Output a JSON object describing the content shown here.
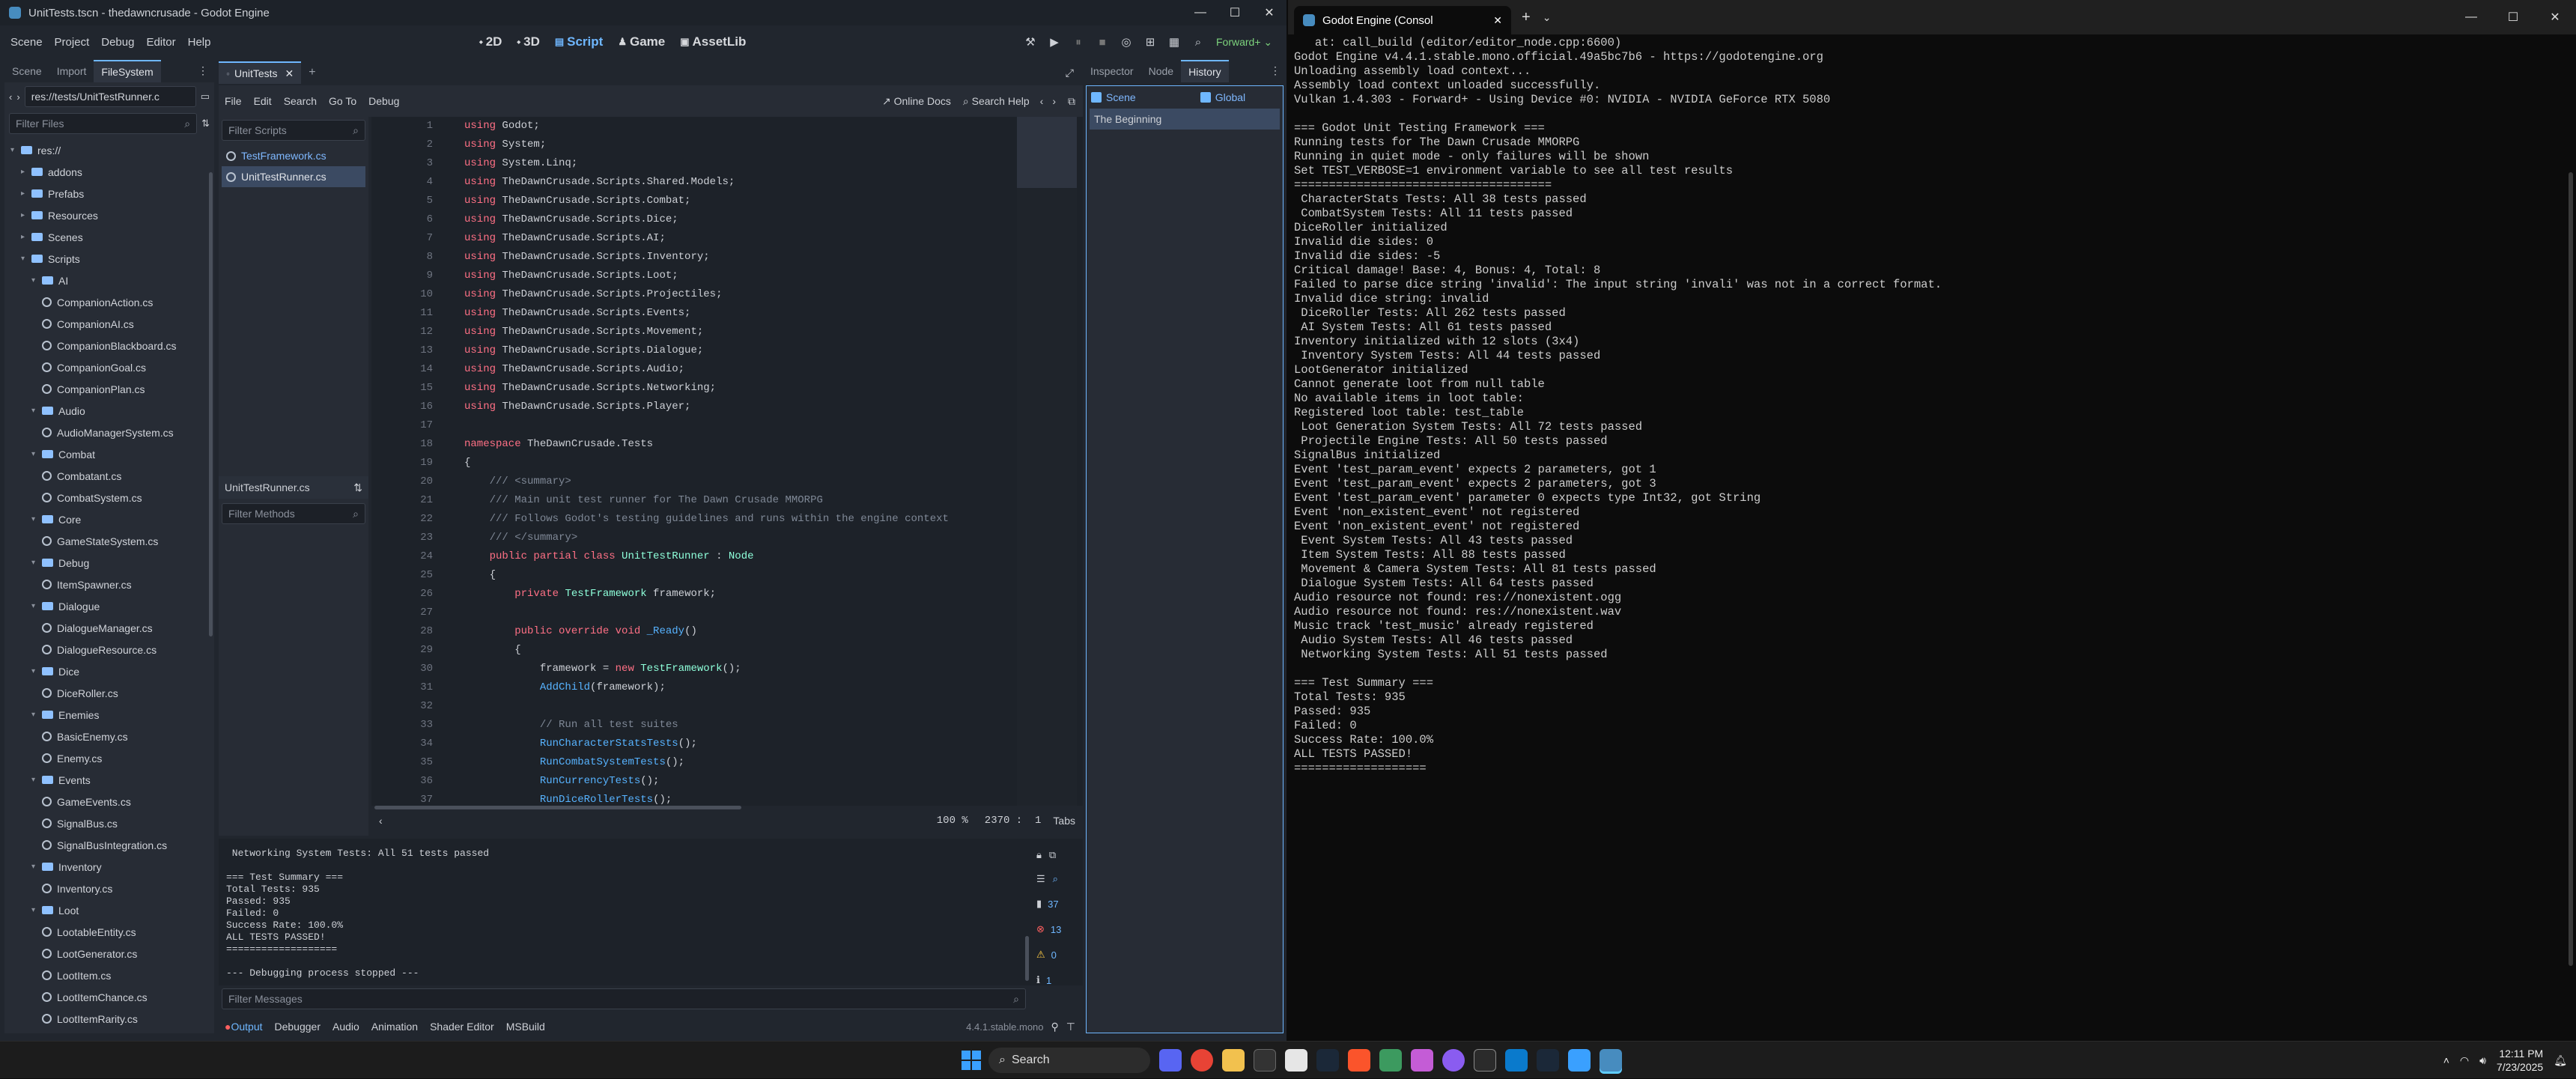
{
  "godot": {
    "window_title": "UnitTests.tscn - thedawncrusade - Godot Engine",
    "menus": [
      "Scene",
      "Project",
      "Debug",
      "Editor",
      "Help"
    ],
    "modes": [
      "2D",
      "3D",
      "Script",
      "Game",
      "AssetLib"
    ],
    "renderer": "Forward+",
    "left_dock": {
      "tabs": [
        "Scene",
        "Import",
        "FileSystem"
      ],
      "path": "res://tests/UnitTestRunner.c",
      "filter_placeholder": "Filter Files",
      "tree": [
        {
          "label": "res://",
          "type": "root"
        },
        {
          "label": "addons",
          "type": "folder",
          "level": 1
        },
        {
          "label": "Prefabs",
          "type": "folder",
          "level": 1
        },
        {
          "label": "Resources",
          "type": "folder",
          "level": 1
        },
        {
          "label": "Scenes",
          "type": "folder",
          "level": 1
        },
        {
          "label": "Scripts",
          "type": "folder",
          "level": 1
        },
        {
          "label": "AI",
          "type": "folder",
          "level": 2
        },
        {
          "label": "CompanionAction.cs",
          "type": "file",
          "level": 3
        },
        {
          "label": "CompanionAI.cs",
          "type": "file",
          "level": 3
        },
        {
          "label": "CompanionBlackboard.cs",
          "type": "file",
          "level": 3
        },
        {
          "label": "CompanionGoal.cs",
          "type": "file",
          "level": 3
        },
        {
          "label": "CompanionPlan.cs",
          "type": "file",
          "level": 3
        },
        {
          "label": "Audio",
          "type": "folder",
          "level": 2
        },
        {
          "label": "AudioManagerSystem.cs",
          "type": "file",
          "level": 3
        },
        {
          "label": "Combat",
          "type": "folder",
          "level": 2
        },
        {
          "label": "Combatant.cs",
          "type": "file",
          "level": 3
        },
        {
          "label": "CombatSystem.cs",
          "type": "file",
          "level": 3
        },
        {
          "label": "Core",
          "type": "folder",
          "level": 2
        },
        {
          "label": "GameStateSystem.cs",
          "type": "file",
          "level": 3
        },
        {
          "label": "Debug",
          "type": "folder",
          "level": 2
        },
        {
          "label": "ItemSpawner.cs",
          "type": "file",
          "level": 3
        },
        {
          "label": "Dialogue",
          "type": "folder",
          "level": 2
        },
        {
          "label": "DialogueManager.cs",
          "type": "file",
          "level": 3
        },
        {
          "label": "DialogueResource.cs",
          "type": "file",
          "level": 3
        },
        {
          "label": "Dice",
          "type": "folder",
          "level": 2
        },
        {
          "label": "DiceRoller.cs",
          "type": "file",
          "level": 3
        },
        {
          "label": "Enemies",
          "type": "folder",
          "level": 2
        },
        {
          "label": "BasicEnemy.cs",
          "type": "file",
          "level": 3
        },
        {
          "label": "Enemy.cs",
          "type": "file",
          "level": 3
        },
        {
          "label": "Events",
          "type": "folder",
          "level": 2
        },
        {
          "label": "GameEvents.cs",
          "type": "file",
          "level": 3
        },
        {
          "label": "SignalBus.cs",
          "type": "file",
          "level": 3
        },
        {
          "label": "SignalBusIntegration.cs",
          "type": "file",
          "level": 3
        },
        {
          "label": "Inventory",
          "type": "folder",
          "level": 2
        },
        {
          "label": "Inventory.cs",
          "type": "file",
          "level": 3
        },
        {
          "label": "Loot",
          "type": "folder",
          "level": 2
        },
        {
          "label": "LootableEntity.cs",
          "type": "file",
          "level": 3
        },
        {
          "label": "LootGenerator.cs",
          "type": "file",
          "level": 3
        },
        {
          "label": "LootItem.cs",
          "type": "file",
          "level": 3
        },
        {
          "label": "LootItemChance.cs",
          "type": "file",
          "level": 3
        },
        {
          "label": "LootItemRarity.cs",
          "type": "file",
          "level": 3
        }
      ]
    },
    "scene_tab": "UnitTests",
    "script_menus": [
      "File",
      "Edit",
      "Search",
      "Go To",
      "Debug"
    ],
    "online_docs": "Online Docs",
    "search_help": "Search Help",
    "filter_scripts": "Filter Scripts",
    "scripts": [
      "TestFramework.cs",
      "UnitTestRunner.cs"
    ],
    "current_script": "UnitTestRunner.cs",
    "filter_methods": "Filter Methods",
    "code_lines": [
      "<span class=kw>using</span> Godot;",
      "<span class=kw>using</span> System;",
      "<span class=kw>using</span> System.Linq;",
      "<span class=kw>using</span> TheDawnCrusade.Scripts.Shared.Models;",
      "<span class=kw>using</span> TheDawnCrusade.Scripts.Combat;",
      "<span class=kw>using</span> TheDawnCrusade.Scripts.Dice;",
      "<span class=kw>using</span> TheDawnCrusade.Scripts.AI;",
      "<span class=kw>using</span> TheDawnCrusade.Scripts.Inventory;",
      "<span class=kw>using</span> TheDawnCrusade.Scripts.Loot;",
      "<span class=kw>using</span> TheDawnCrusade.Scripts.Projectiles;",
      "<span class=kw>using</span> TheDawnCrusade.Scripts.Events;",
      "<span class=kw>using</span> TheDawnCrusade.Scripts.Movement;",
      "<span class=kw>using</span> TheDawnCrusade.Scripts.Dialogue;",
      "<span class=kw>using</span> TheDawnCrusade.Scripts.Audio;",
      "<span class=kw>using</span> TheDawnCrusade.Scripts.Networking;",
      "<span class=kw>using</span> TheDawnCrusade.Scripts.Player;",
      "",
      "<span class=kw>namespace</span> TheDawnCrusade.Tests",
      "{",
      "    <span class=cm>/// &lt;summary&gt;</span>",
      "    <span class=cm>/// Main unit test runner for The Dawn Crusade MMORPG</span>",
      "    <span class=cm>/// Follows Godot's testing guidelines and runs within the engine context</span>",
      "    <span class=cm>/// &lt;/summary&gt;</span>",
      "    <span class=kw>public partial class</span> <span class=ty>UnitTestRunner</span> : <span class=ty>Node</span>",
      "    {",
      "        <span class=kw>private</span> <span class=ty>TestFramework</span> framework;",
      "",
      "        <span class=kw>public override void</span> <span class=fn>_Ready</span>()",
      "        {",
      "            framework = <span class=kw>new</span> <span class=ty>TestFramework</span>();",
      "            <span class=fn>AddChild</span>(framework);",
      "",
      "            <span class=cm>// Run all test suites</span>",
      "            <span class=fn>RunCharacterStatsTests</span>();",
      "            <span class=fn>RunCombatSystemTests</span>();",
      "            <span class=fn>RunCurrencyTests</span>();",
      "            <span class=fn>RunDiceRollerTests</span>();"
    ],
    "zoom": "100 %",
    "cursor_line": "2370",
    "cursor_col": "1",
    "indent_mode": "Tabs",
    "right_dock_tabs": [
      "Inspector",
      "Node",
      "History"
    ],
    "history_scene": "Scene",
    "history_global": "Global",
    "history_item": "The Beginning",
    "output_text": " Networking System Tests: All 51 tests passed\n\n=== Test Summary ===\nTotal Tests: 935\nPassed: 935\nFailed: 0\nSuccess Rate: 100.0%\nALL TESTS PASSED!\n===================\n\n--- Debugging process stopped ---",
    "output_counts": {
      "messages": "37",
      "errors": "13",
      "warnings": "0",
      "info": "1"
    },
    "filter_messages": "Filter Messages",
    "bottom_tabs": [
      "Output",
      "Debugger",
      "Audio",
      "Animation",
      "Shader Editor",
      "MSBuild"
    ],
    "version": "4.4.1.stable.mono"
  },
  "console": {
    "tab_title": "Godot Engine (Consol",
    "lines": [
      "   at: call_build (editor/editor_node.cpp:6600)",
      "Godot Engine v4.4.1.stable.mono.official.49a5bc7b6 - https://godotengine.org",
      "Unloading assembly load context...",
      "Assembly load context unloaded successfully.",
      "Vulkan 1.4.303 - Forward+ - Using Device #0: NVIDIA - NVIDIA GeForce RTX 5080",
      "",
      "=== Godot Unit Testing Framework ===",
      "Running tests for The Dawn Crusade MMORPG",
      "Running in quiet mode - only failures will be shown",
      "Set TEST_VERBOSE=1 environment variable to see all test results",
      "=====================================",
      " CharacterStats Tests: All 38 tests passed",
      " CombatSystem Tests: All 11 tests passed",
      "DiceRoller initialized",
      "Invalid die sides: 0",
      "Invalid die sides: -5",
      "Critical damage! Base: 4, Bonus: 4, Total: 8",
      "Failed to parse dice string 'invalid': The input string 'invali' was not in a correct format.",
      "Invalid dice string: invalid",
      " DiceRoller Tests: All 262 tests passed",
      " AI System Tests: All 61 tests passed",
      "Inventory initialized with 12 slots (3x4)",
      " Inventory System Tests: All 44 tests passed",
      "LootGenerator initialized",
      "Cannot generate loot from null table",
      "No available items in loot table:",
      "Registered loot table: test_table",
      " Loot Generation System Tests: All 72 tests passed",
      " Projectile Engine Tests: All 50 tests passed",
      "SignalBus initialized",
      "Event 'test_param_event' expects 2 parameters, got 1",
      "Event 'test_param_event' expects 2 parameters, got 3",
      "Event 'test_param_event' parameter 0 expects type Int32, got String",
      "Event 'non_existent_event' not registered",
      "Event 'non_existent_event' not registered",
      " Event System Tests: All 43 tests passed",
      " Item System Tests: All 88 tests passed",
      " Movement & Camera System Tests: All 81 tests passed",
      " Dialogue System Tests: All 64 tests passed",
      "Audio resource not found: res://nonexistent.ogg",
      "Audio resource not found: res://nonexistent.wav",
      "Music track 'test_music' already registered",
      " Audio System Tests: All 46 tests passed",
      " Networking System Tests: All 51 tests passed",
      "",
      "=== Test Summary ===",
      "Total Tests: 935",
      "Passed: 935",
      "Failed: 0",
      "Success Rate: 100.0%",
      "ALL TESTS PASSED!",
      "==================="
    ]
  },
  "taskbar": {
    "search_label": "Search",
    "time": "12:11 PM",
    "date": "7/23/2025"
  }
}
